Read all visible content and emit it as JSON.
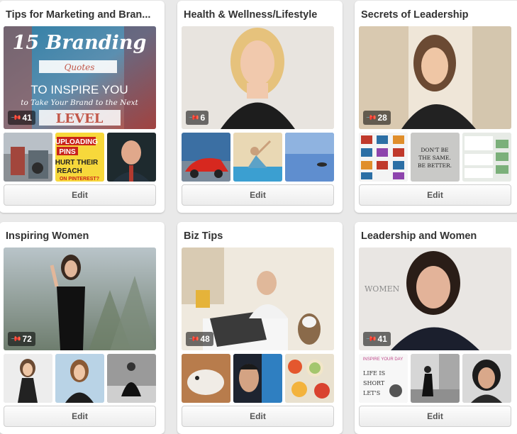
{
  "boards": [
    {
      "title": "Tips for Marketing and Bran...",
      "pin_count": "41",
      "cover_text": [
        "15 Branding",
        "Quotes",
        "TO INSPIRE YOU",
        "to Take Your Brand to the Next",
        "LEVEL"
      ],
      "thumb2_text": [
        "UPLOADING",
        "PINS",
        "HURT THEIR",
        "REACH",
        "ON PINTEREST?"
      ],
      "edit_label": "Edit"
    },
    {
      "title": "Health & Wellness/Lifestyle",
      "pin_count": "6",
      "edit_label": "Edit"
    },
    {
      "title": "Secrets of Leadership",
      "pin_count": "28",
      "thumb2_text": [
        "DON'T BE",
        "THE SAME.",
        "BE BETTER."
      ],
      "edit_label": "Edit"
    },
    {
      "title": "Inspiring Women",
      "pin_count": "72",
      "edit_label": "Edit"
    },
    {
      "title": "Biz Tips",
      "pin_count": "48",
      "edit_label": "Edit"
    },
    {
      "title": "Leadership and Women",
      "pin_count": "41",
      "cover_text": [
        "WOMEN"
      ],
      "thumb1_text": [
        "INSPIRE YOUR DAY",
        "LIFE IS",
        "SHORT",
        "LET'S"
      ],
      "edit_label": "Edit"
    }
  ],
  "icons": {
    "pin": "pushpin-icon"
  },
  "colors": {
    "page_background": "#e9e9e9",
    "card_background": "#ffffff",
    "badge_background": "rgba(0,0,0,0.55)"
  }
}
